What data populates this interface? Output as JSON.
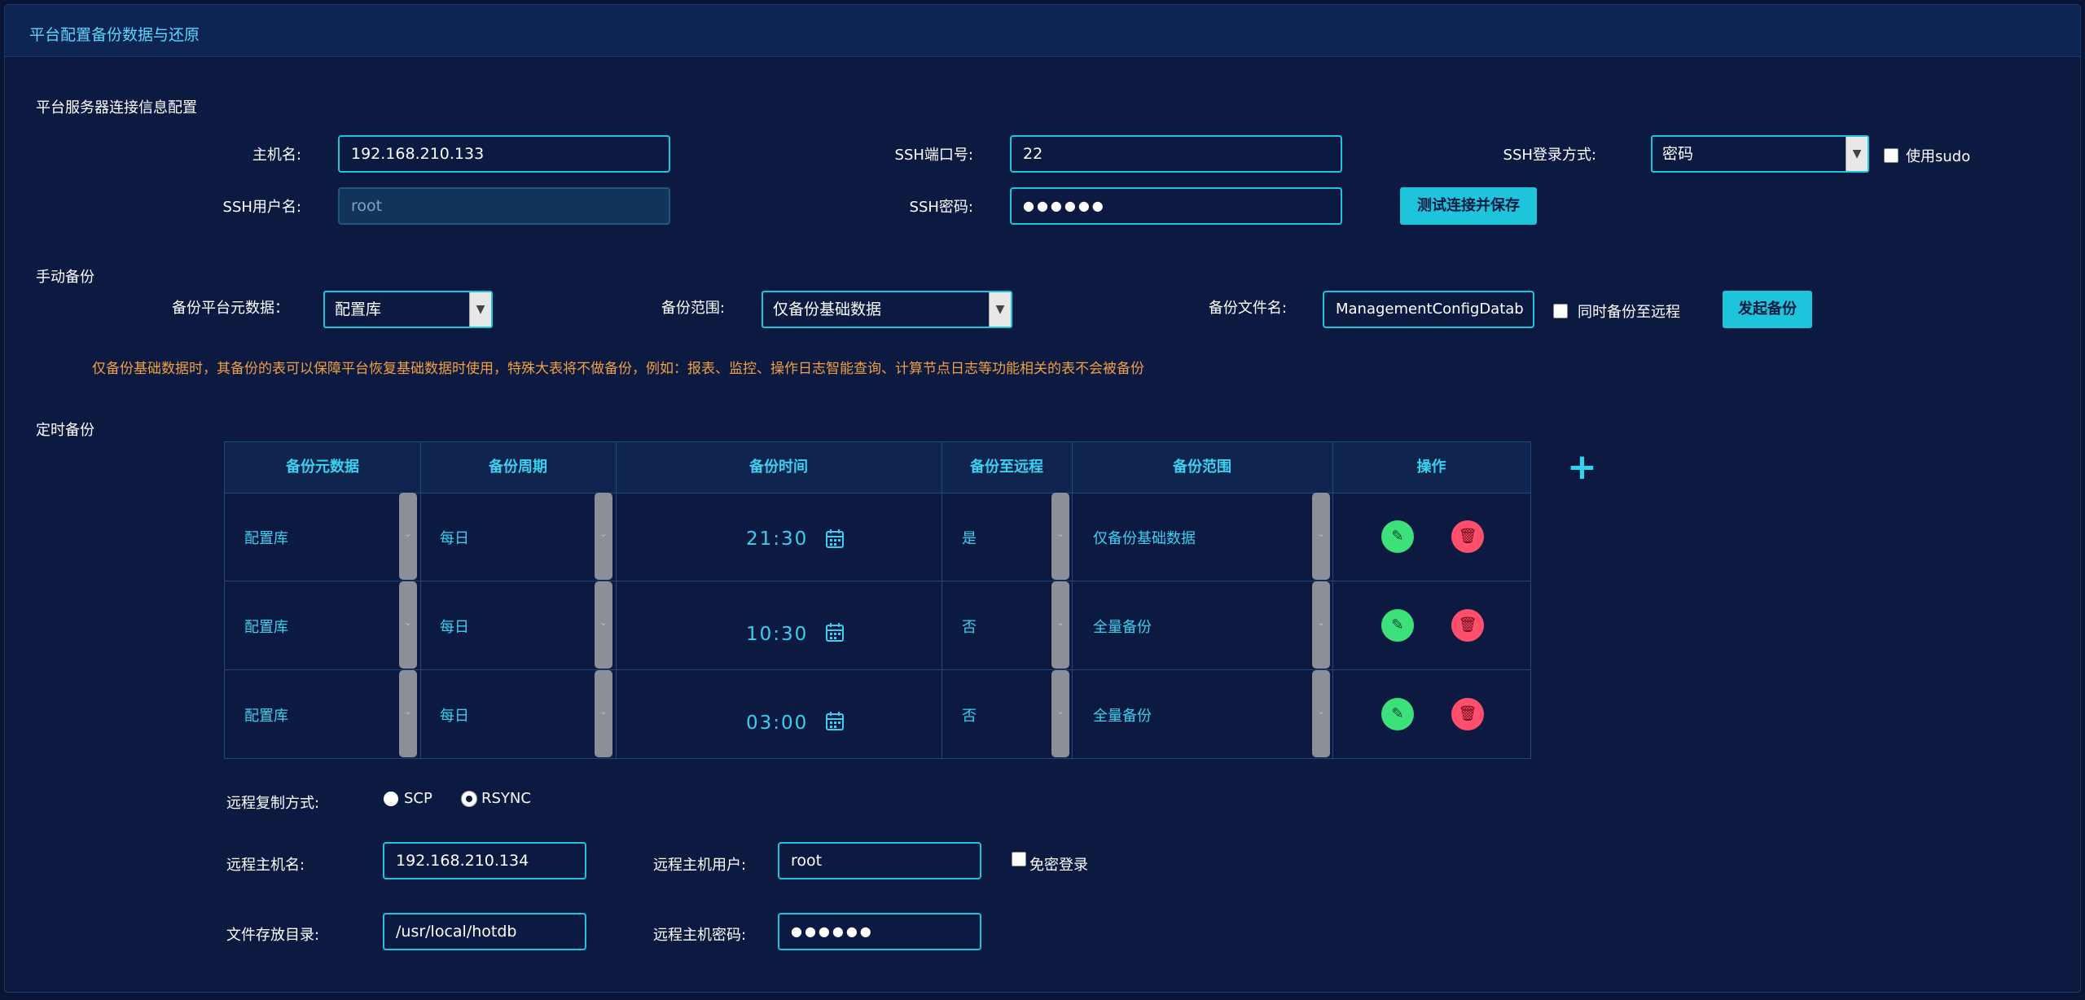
{
  "title": "平台配置备份数据与还原",
  "server": {
    "heading": "平台服务器连接信息配置",
    "host_label": "主机名:",
    "host_value": "192.168.210.133",
    "ssh_port_label": "SSH端口号:",
    "ssh_port_value": "22",
    "ssh_login_label": "SSH登录方式:",
    "ssh_login_value": "密码",
    "use_sudo_label": "使用sudo",
    "ssh_user_label": "SSH用户名:",
    "ssh_user_value": "root",
    "ssh_pwd_label": "SSH密码:",
    "ssh_pwd_value": "●●●●●●",
    "test_save_button": "测试连接并保存"
  },
  "manual": {
    "heading": "手动备份",
    "meta_label": "备份平台元数据：",
    "meta_value": "配置库",
    "scope_label": "备份范围:",
    "scope_value": "仅备份基础数据",
    "file_label": "备份文件名:",
    "file_value": "ManagementConfigDatab",
    "remote_check_label": "同时备份至远程",
    "start_button": "发起备份",
    "note": "仅备份基础数据时，其备份的表可以保障平台恢复基础数据时使用，特殊大表将不做备份，例如：报表、监控、操作日志智能查询、计算节点日志等功能相关的表不会被备份"
  },
  "scheduled": {
    "heading": "定时备份",
    "columns": [
      "备份元数据",
      "备份周期",
      "备份时间",
      "备份至远程",
      "备份范围",
      "操作"
    ],
    "rows": [
      {
        "meta": "配置库",
        "cycle": "每日",
        "time": "21:30",
        "remote": "是",
        "scope": "仅备份基础数据"
      },
      {
        "meta": "配置库",
        "cycle": "每日",
        "time": "10:30",
        "remote": "否",
        "scope": "全量备份"
      },
      {
        "meta": "配置库",
        "cycle": "每日",
        "time": "03:00",
        "remote": "否",
        "scope": "全量备份"
      }
    ],
    "add_icon": "plus-icon"
  },
  "remote": {
    "copy_method_label": "远程复制方式:",
    "option_scp": "SCP",
    "option_rsync": "RSYNC",
    "selected": "RSYNC",
    "host_label": "远程主机名:",
    "host_value": "192.168.210.134",
    "user_label": "远程主机用户:",
    "user_value": "root",
    "nopass_label": "免密登录",
    "dir_label": "文件存放目录:",
    "dir_value": "/usr/local/hotdb",
    "pwd_label": "远程主机密码:",
    "pwd_value": "●●●●●●"
  },
  "colors": {
    "accent": "#1ec4dc",
    "background": "#0c1a42",
    "note": "#f0a040",
    "edit": "#3de07a",
    "delete": "#ff4f6a"
  }
}
